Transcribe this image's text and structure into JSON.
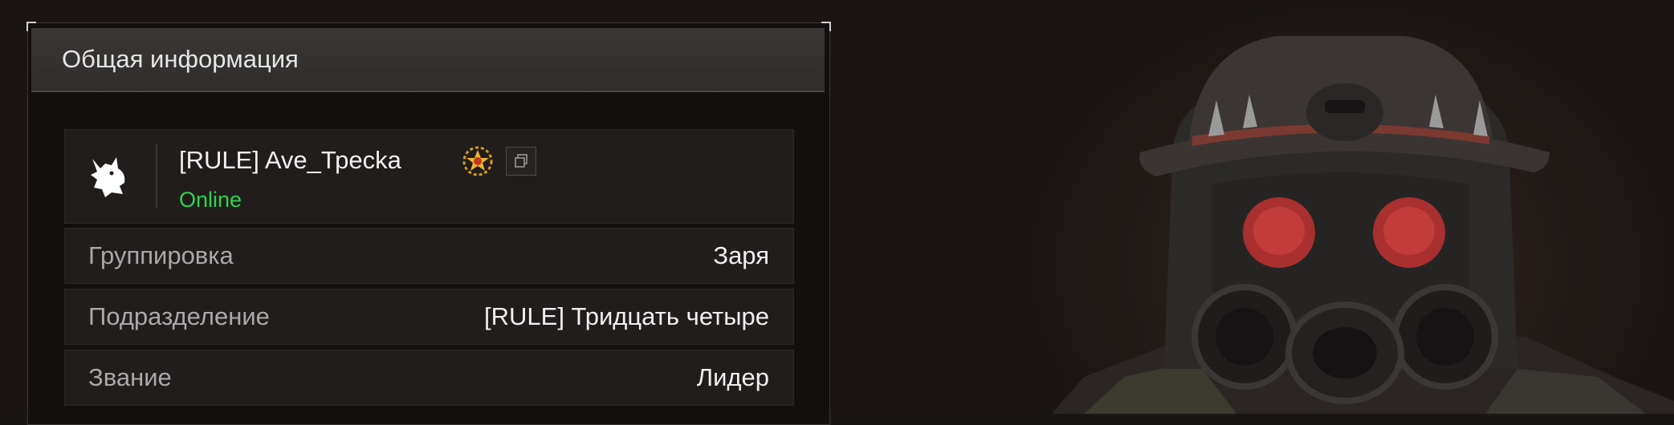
{
  "panel": {
    "title": "Общая информация"
  },
  "profile": {
    "player_name": "[RULE] Ave_Трecka",
    "status": "Online",
    "status_color": "#2dd44a",
    "avatar_icon": "wolf-icon",
    "badge_icon": "rank-badge-icon",
    "copy_icon": "copy-icon"
  },
  "info_rows": [
    {
      "label": "Группировка",
      "value": "Заря"
    },
    {
      "label": "Подразделение",
      "value": "[RULE] Тридцать четыре"
    },
    {
      "label": "Звание",
      "value": "Лидер"
    }
  ]
}
